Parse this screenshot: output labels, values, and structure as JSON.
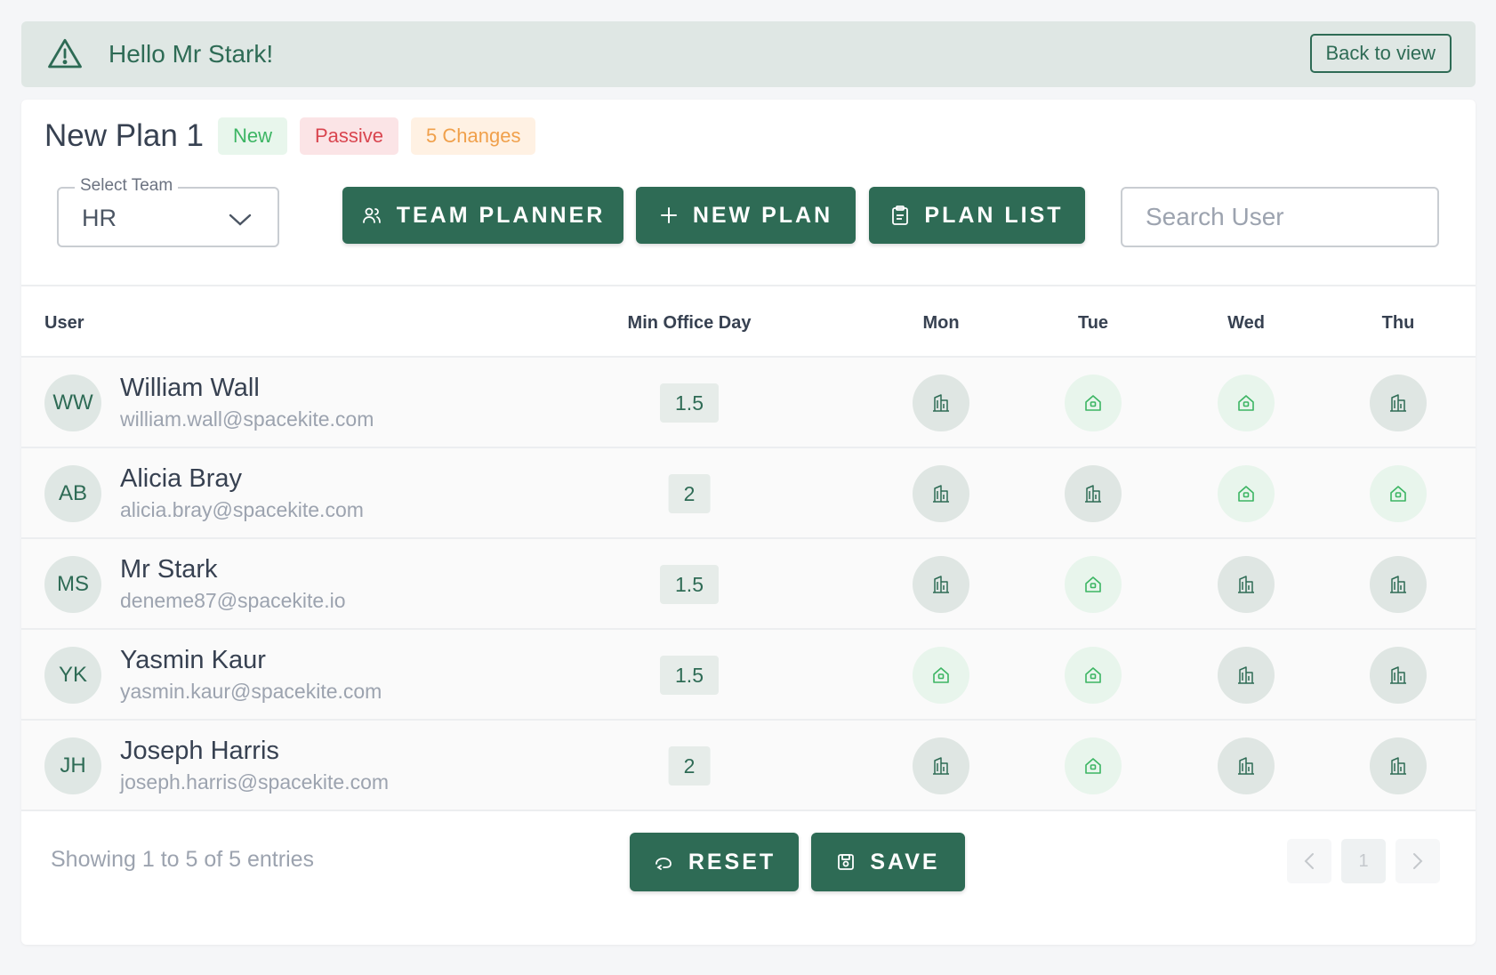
{
  "alert": {
    "greeting": "Hello Mr Stark!",
    "back_label": "Back to view"
  },
  "plan": {
    "title": "New Plan 1",
    "badges": {
      "new": "New",
      "passive": "Passive",
      "changes": "5 Changes"
    }
  },
  "team_select": {
    "legend": "Select Team",
    "value": "HR"
  },
  "toolbar": {
    "team_planner": "TEAM PLANNER",
    "new_plan": "NEW PLAN",
    "plan_list": "PLAN LIST"
  },
  "search": {
    "placeholder": "Search User"
  },
  "table": {
    "headers": {
      "user": "User",
      "min_office_day": "Min Office Day",
      "mon": "Mon",
      "tue": "Tue",
      "wed": "Wed",
      "thu": "Thu"
    },
    "rows": [
      {
        "initials": "WW",
        "name": "William Wall",
        "email": "william.wall@spacekite.com",
        "min": "1.5",
        "days": [
          "office",
          "home",
          "home",
          "office"
        ]
      },
      {
        "initials": "AB",
        "name": "Alicia Bray",
        "email": "alicia.bray@spacekite.com",
        "min": "2",
        "days": [
          "office",
          "office",
          "home",
          "home"
        ]
      },
      {
        "initials": "MS",
        "name": "Mr Stark",
        "email": "deneme87@spacekite.io",
        "min": "1.5",
        "days": [
          "office",
          "home",
          "office",
          "office"
        ]
      },
      {
        "initials": "YK",
        "name": "Yasmin Kaur",
        "email": "yasmin.kaur@spacekite.com",
        "min": "1.5",
        "days": [
          "home",
          "home",
          "office",
          "office"
        ]
      },
      {
        "initials": "JH",
        "name": "Joseph Harris",
        "email": "joseph.harris@spacekite.com",
        "min": "2",
        "days": [
          "office",
          "home",
          "office",
          "office"
        ]
      }
    ]
  },
  "footer": {
    "showing": "Showing 1 to 5 of 5 entries",
    "reset": "RESET",
    "save": "SAVE",
    "page": "1"
  },
  "icons": {
    "office": "building-icon",
    "home": "home-icon"
  },
  "colors": {
    "primary": "#2e6b55",
    "office_bg": "#dfe6e3",
    "home_bg": "#e8f5ec",
    "home_icon": "#3cb563"
  }
}
